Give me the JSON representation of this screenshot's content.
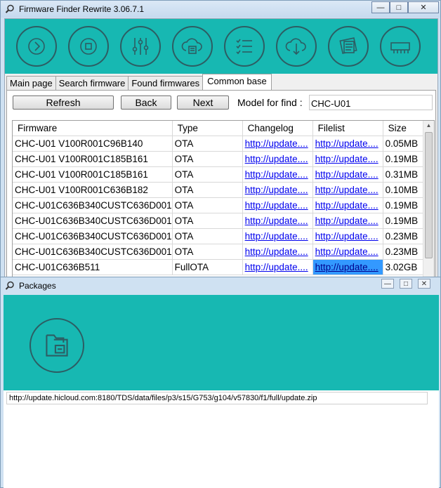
{
  "main_window": {
    "title": "Firmware Finder Rewrite 3.06.7.1",
    "minimize": "—",
    "maximize": "□",
    "close": "✕"
  },
  "toolbar_icons": [
    "chevron-right-icon",
    "stop-icon",
    "sliders-icon",
    "cloud-upload-icon",
    "checklist-icon",
    "cloud-download-icon",
    "firmware-card-icon",
    "memory-chip-icon"
  ],
  "tabs": [
    "Main page",
    "Search firmware",
    "Found firmwares",
    "Common base"
  ],
  "active_tab": "Common base",
  "buttons": {
    "refresh": "Refresh",
    "back": "Back",
    "next": "Next"
  },
  "model": {
    "label": "Model for find :",
    "value": "CHC-U01"
  },
  "table": {
    "columns": [
      "Firmware",
      "Type",
      "Changelog",
      "Filelist",
      "Size"
    ],
    "rows": [
      {
        "firmware": "CHC-U01 V100R001C96B140",
        "type": "OTA",
        "changelog": "http://update....",
        "filelist": "http://update....",
        "size": "0.05MB"
      },
      {
        "firmware": "CHC-U01 V100R001C185B161",
        "type": "OTA",
        "changelog": "http://update....",
        "filelist": "http://update....",
        "size": "0.19MB"
      },
      {
        "firmware": "CHC-U01 V100R001C185B161",
        "type": "OTA",
        "changelog": "http://update....",
        "filelist": "http://update....",
        "size": "0.31MB"
      },
      {
        "firmware": "CHC-U01 V100R001C636B182",
        "type": "OTA",
        "changelog": "http://update....",
        "filelist": "http://update....",
        "size": "0.10MB"
      },
      {
        "firmware": "CHC-U01C636B340CUSTC636D001",
        "type": "OTA",
        "changelog": "http://update....",
        "filelist": "http://update....",
        "size": "0.19MB"
      },
      {
        "firmware": "CHC-U01C636B340CUSTC636D001",
        "type": "OTA",
        "changelog": "http://update....",
        "filelist": "http://update....",
        "size": "0.19MB"
      },
      {
        "firmware": "CHC-U01C636B340CUSTC636D001",
        "type": "OTA",
        "changelog": "http://update....",
        "filelist": "http://update....",
        "size": "0.23MB"
      },
      {
        "firmware": "CHC-U01C636B340CUSTC636D001",
        "type": "OTA",
        "changelog": "http://update....",
        "filelist": "http://update....",
        "size": "0.23MB"
      },
      {
        "firmware": "CHC-U01C636B511",
        "type": "FullOTA",
        "changelog": "http://update....",
        "filelist": "http://update....",
        "size": "3.02GB"
      }
    ],
    "selected_row": 8,
    "selected_column": "filelist"
  },
  "packages_window": {
    "title": "Packages",
    "minimize": "—",
    "maximize": "□",
    "close": "✕",
    "icon": "folder-icon",
    "url": "http://update.hicloud.com:8180/TDS/data/files/p3/s15/G753/g104/v57830/f1/full/update.zip"
  },
  "colors": {
    "accent": "#17b8b2",
    "icon_stroke": "#2d5d63",
    "link": "#0000ee",
    "selection": "#3399ff"
  }
}
